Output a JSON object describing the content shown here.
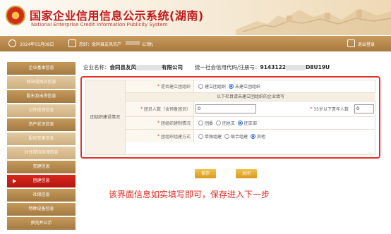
{
  "header": {
    "title_cn": "国家企业信用信息公示系统(湖南)",
    "title_en": "National Enterprise Credit Information Publicity System"
  },
  "topbar": {
    "date": "2024年01月08日",
    "welcome": "您好：会同县友风农产",
    "company_mid": "公司",
    "user": "丸",
    "logout": "退出登录"
  },
  "sidebar": {
    "items": [
      {
        "label": "企业基本信息",
        "style": "dark"
      },
      {
        "label": "网站或网店信息",
        "style": "light"
      },
      {
        "label": "股东及出资信息",
        "style": "dark"
      },
      {
        "label": "对外投资信息",
        "style": "light"
      },
      {
        "label": "资产状况信息",
        "style": "dark"
      },
      {
        "label": "股权变更信息",
        "style": "light"
      },
      {
        "label": "对外提供担保信息",
        "style": "light"
      },
      {
        "label": "党建信息",
        "style": "dark"
      },
      {
        "label": "团建信息",
        "style": "active"
      },
      {
        "label": "社保信息",
        "style": "dark"
      },
      {
        "label": "特种设备信息",
        "style": "dark"
      },
      {
        "label": "预览并公示",
        "style": "dark"
      }
    ]
  },
  "company": {
    "name_label": "企业名称：",
    "name_part1": "会同县友风",
    "name_part2": "有限公司",
    "code_label": "统一社会信用代码/注册号：",
    "code_part1": "9143122",
    "code_part2": "D8U19U"
  },
  "form": {
    "section_label": "团组织建设情况",
    "q1_label": "是否建立团组织",
    "q1_options": [
      "建立团组织",
      "未建立团组织"
    ],
    "banner": "以下栏目请未建立团组织的企业填写",
    "q2_label": "团员人数（含预备团员）",
    "q2_value": "0",
    "q3_label": "35岁以下青年人数",
    "q3_value": "0",
    "q4_label": "团组织建制情况",
    "q4_options": [
      "团委",
      "团总支",
      "团支部"
    ],
    "q5_label": "团组织组建方式",
    "q5_options": [
      "单独组建",
      "联合组建",
      "其他"
    ]
  },
  "buttons": {
    "save": "保存",
    "close": "关闭"
  },
  "note": "该界面信息如实填写即可，保存进入下一步",
  "colors": {
    "accent_red": "#e4322a",
    "sidebar_brown": "#a47a43",
    "button_gold": "#d99a1c",
    "radio_blue": "#2d6be0"
  }
}
